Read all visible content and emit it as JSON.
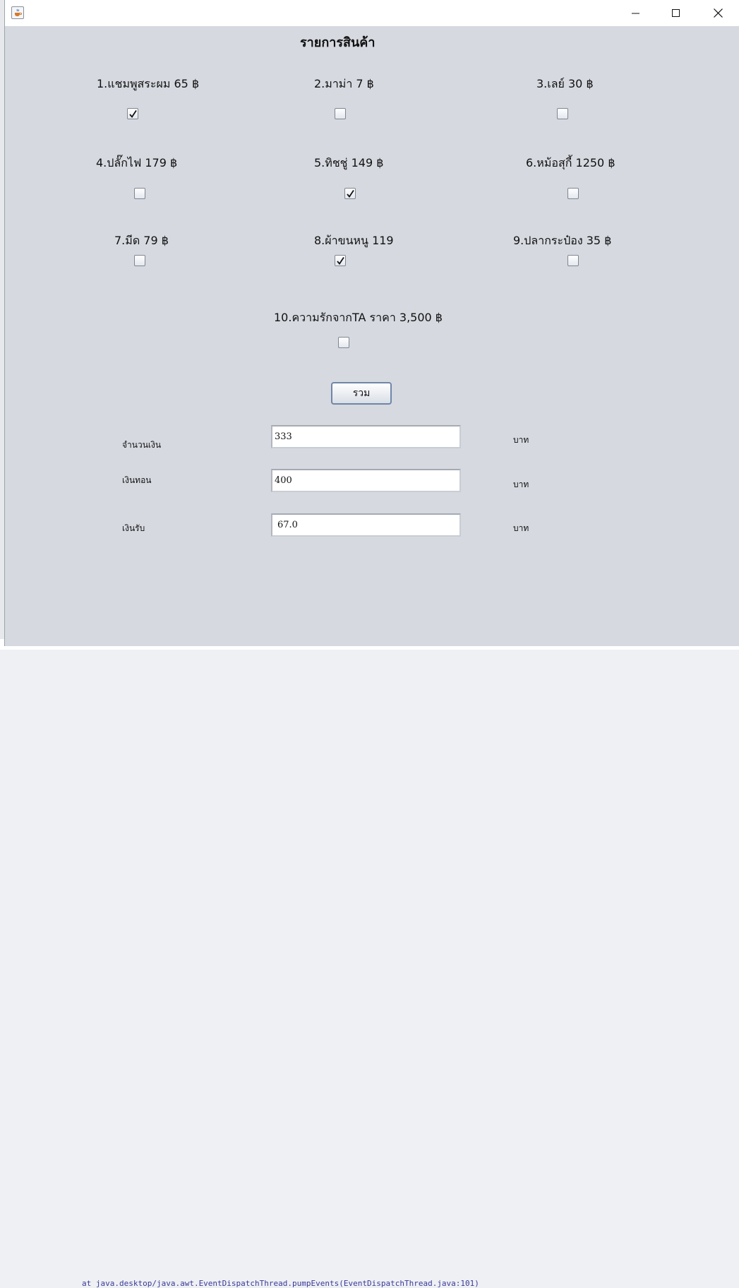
{
  "window": {
    "minimize_glyph": "—",
    "maximize_glyph": "☐",
    "close_glyph": "✕"
  },
  "title": "รายการสินค้า",
  "items": [
    {
      "label": "1.แชมพูสระผม  65  ฿",
      "checked": true
    },
    {
      "label": "2.มาม่า  7 ฿",
      "checked": false
    },
    {
      "label": "3.เลย์  30 ฿",
      "checked": false
    },
    {
      "label": "4.ปลั๊กไฟ  179 ฿",
      "checked": false
    },
    {
      "label": "5.ทิชชู่  149 ฿",
      "checked": true
    },
    {
      "label": "6.หม้อสุกี้  1250 ฿",
      "checked": false
    },
    {
      "label": "7.มีด  79 ฿",
      "checked": false
    },
    {
      "label": "8.ผ้าขนหนู  119",
      "checked": true
    },
    {
      "label": "9.ปลากระป๋อง  35 ฿",
      "checked": false
    },
    {
      "label": "10.ความรักจากTA  ราคา 3,500 ฿",
      "checked": false
    }
  ],
  "total_button": "รวม",
  "fields": [
    {
      "label": "จำนวนเงิน",
      "value": "333",
      "unit": "บาท"
    },
    {
      "label": "เงินทอน",
      "value": "400",
      "unit": "บาท"
    },
    {
      "label": "เงินรับ",
      "value": "67.0",
      "unit": "บาท"
    }
  ],
  "background_text": "at java.desktop/java.awt.EventDispatchThread.pumpEvents(EventDispatchThread.java:101)"
}
